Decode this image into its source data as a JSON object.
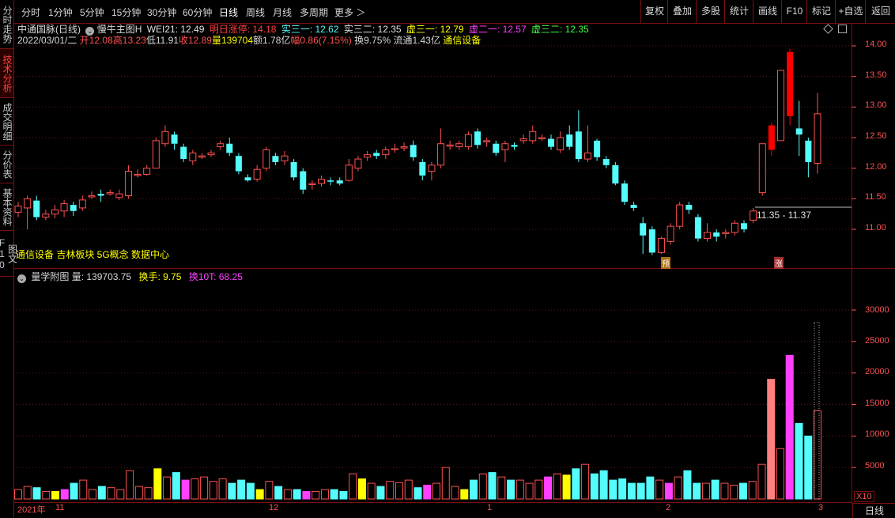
{
  "left_tabs": [
    {
      "label": "分时走势",
      "active": false
    },
    {
      "label": "技术分析",
      "active": true
    },
    {
      "label": "成交明细",
      "active": false
    },
    {
      "label": "分价表",
      "active": false
    },
    {
      "label": "基本资料",
      "active": false
    },
    {
      "label": "图文F10",
      "active": false
    }
  ],
  "toolbar": {
    "periods": [
      "分时",
      "1分钟",
      "5分钟",
      "15分钟",
      "30分钟",
      "60分钟",
      "日线",
      "周线",
      "月线",
      "多周期",
      "更多 ＞"
    ],
    "active_period": "日线",
    "right_buttons": [
      "复权",
      "叠加",
      "多股",
      "统计",
      "画线",
      "F10",
      "标记",
      "+自选",
      "返回"
    ]
  },
  "main_header": {
    "stock_title": "中通国脉(日线)",
    "indicator_name": "慢牛主图H",
    "wei21": "WEI21: 12.49",
    "limit_up": "明日涨停: 14.18",
    "shi31": "实三一: 12.62",
    "shi32": "实三二: 12.35",
    "xu31": "虚三一: 12.79",
    "xu21": "虚二一: 12.57",
    "xu32": "虚三二: 12.35"
  },
  "quote_line": {
    "date": "2022/03/01/二",
    "open": "开12.08",
    "high": "高13.23",
    "low": "低11.91",
    "close": "收12.89",
    "volume": "量139704",
    "amount": "额1.78亿",
    "change": "幅0.86(7.15%)",
    "turnover": "换9.75%",
    "float": "流通1.43亿",
    "industry": "通信设备"
  },
  "concepts": "通信设备 吉林板块 5G概念 数据中心",
  "range_label": "11.35 - 11.37",
  "markers": {
    "pre": "预",
    "up": "涨"
  },
  "sub_header": {
    "name": "量学附图",
    "vol": "量: 139703.75",
    "turnover": "换手: 9.75",
    "turnover10": "换10T: 68.25"
  },
  "price_axis": [
    "14.00",
    "13.50",
    "13.00",
    "12.50",
    "12.00",
    "11.50",
    "11.00"
  ],
  "volume_axis": [
    "30000",
    "25000",
    "20000",
    "15000",
    "10000",
    "5000"
  ],
  "x_labels": [
    "2021年",
    "11",
    "12",
    "1",
    "2",
    "3"
  ],
  "x10": "X10",
  "period_btn": "日线",
  "colors": {
    "up": "#ff5050",
    "down": "#54fcfc",
    "strong_up": "#ff0000",
    "bg": "#000000",
    "border": "#7a1010",
    "accent": "#ffff00",
    "magenta": "#ff40ff"
  },
  "chart_data": {
    "type": "candlestick",
    "ylim": [
      10.6,
      14.25
    ],
    "candles": [
      {
        "o": 11.28,
        "c": 11.38,
        "h": 11.45,
        "l": 11.2
      },
      {
        "o": 11.35,
        "c": 11.5,
        "h": 11.55,
        "l": 11.0
      },
      {
        "o": 11.47,
        "c": 11.2,
        "h": 11.55,
        "l": 11.15
      },
      {
        "o": 11.2,
        "c": 11.25,
        "h": 11.32,
        "l": 11.15
      },
      {
        "o": 11.25,
        "c": 11.32,
        "h": 11.4,
        "l": 11.18
      },
      {
        "o": 11.3,
        "c": 11.42,
        "h": 11.48,
        "l": 11.2
      },
      {
        "o": 11.4,
        "c": 11.3,
        "h": 11.45,
        "l": 11.22
      },
      {
        "o": 11.35,
        "c": 11.48,
        "h": 11.55,
        "l": 11.3
      },
      {
        "o": 11.55,
        "c": 11.55,
        "h": 11.62,
        "l": 11.5
      },
      {
        "o": 11.58,
        "c": 11.55,
        "h": 11.65,
        "l": 11.45
      },
      {
        "o": 11.6,
        "c": 11.6,
        "h": 11.65,
        "l": 11.55
      },
      {
        "o": 11.52,
        "c": 11.58,
        "h": 11.65,
        "l": 11.48
      },
      {
        "o": 11.55,
        "c": 11.95,
        "h": 12.05,
        "l": 11.5
      },
      {
        "o": 11.9,
        "c": 11.9,
        "h": 11.98,
        "l": 11.85
      },
      {
        "o": 11.9,
        "c": 12.0,
        "h": 12.05,
        "l": 11.88
      },
      {
        "o": 12.0,
        "c": 12.45,
        "h": 12.5,
        "l": 12.0
      },
      {
        "o": 12.4,
        "c": 12.6,
        "h": 12.7,
        "l": 12.35
      },
      {
        "o": 12.55,
        "c": 12.4,
        "h": 12.6,
        "l": 12.3
      },
      {
        "o": 12.35,
        "c": 12.15,
        "h": 12.4,
        "l": 12.1
      },
      {
        "o": 12.12,
        "c": 12.25,
        "h": 12.3,
        "l": 12.05
      },
      {
        "o": 12.2,
        "c": 12.2,
        "h": 12.25,
        "l": 12.15
      },
      {
        "o": 12.22,
        "c": 12.25,
        "h": 12.3,
        "l": 12.18
      },
      {
        "o": 12.35,
        "c": 12.4,
        "h": 12.45,
        "l": 12.3
      },
      {
        "o": 12.4,
        "c": 12.25,
        "h": 12.5,
        "l": 12.2
      },
      {
        "o": 12.2,
        "c": 11.95,
        "h": 12.25,
        "l": 11.9
      },
      {
        "o": 11.85,
        "c": 11.8,
        "h": 11.9,
        "l": 11.78
      },
      {
        "o": 11.82,
        "c": 11.98,
        "h": 12.05,
        "l": 11.78
      },
      {
        "o": 12.0,
        "c": 12.3,
        "h": 12.35,
        "l": 11.95
      },
      {
        "o": 12.2,
        "c": 12.1,
        "h": 12.25,
        "l": 12.05
      },
      {
        "o": 12.12,
        "c": 12.2,
        "h": 12.28,
        "l": 12.05
      },
      {
        "o": 12.1,
        "c": 11.85,
        "h": 12.15,
        "l": 11.8
      },
      {
        "o": 11.95,
        "c": 11.65,
        "h": 12.0,
        "l": 11.58
      },
      {
        "o": 11.75,
        "c": 11.75,
        "h": 11.8,
        "l": 11.65
      },
      {
        "o": 11.75,
        "c": 11.82,
        "h": 11.88,
        "l": 11.7
      },
      {
        "o": 11.8,
        "c": 11.78,
        "h": 11.85,
        "l": 11.72
      },
      {
        "o": 11.8,
        "c": 11.75,
        "h": 11.85,
        "l": 11.72
      },
      {
        "o": 11.8,
        "c": 12.05,
        "h": 12.15,
        "l": 11.78
      },
      {
        "o": 12.0,
        "c": 12.15,
        "h": 12.2,
        "l": 11.95
      },
      {
        "o": 12.18,
        "c": 12.22,
        "h": 12.28,
        "l": 12.12
      },
      {
        "o": 12.25,
        "c": 12.2,
        "h": 12.3,
        "l": 12.15
      },
      {
        "o": 12.22,
        "c": 12.3,
        "h": 12.35,
        "l": 12.15
      },
      {
        "o": 12.32,
        "c": 12.32,
        "h": 12.4,
        "l": 12.25
      },
      {
        "o": 12.35,
        "c": 12.35,
        "h": 12.42,
        "l": 12.28
      },
      {
        "o": 12.38,
        "c": 12.18,
        "h": 12.45,
        "l": 12.12
      },
      {
        "o": 12.1,
        "c": 11.88,
        "h": 12.15,
        "l": 11.8
      },
      {
        "o": 11.95,
        "c": 12.05,
        "h": 12.1,
        "l": 11.8
      },
      {
        "o": 12.05,
        "c": 12.4,
        "h": 12.65,
        "l": 12.0
      },
      {
        "o": 12.38,
        "c": 12.38,
        "h": 12.45,
        "l": 12.3
      },
      {
        "o": 12.35,
        "c": 12.4,
        "h": 12.45,
        "l": 12.3
      },
      {
        "o": 12.35,
        "c": 12.55,
        "h": 12.6,
        "l": 12.3
      },
      {
        "o": 12.6,
        "c": 12.38,
        "h": 12.65,
        "l": 12.32
      },
      {
        "o": 12.45,
        "c": 12.45,
        "h": 12.5,
        "l": 12.35
      },
      {
        "o": 12.4,
        "c": 12.25,
        "h": 12.45,
        "l": 12.2
      },
      {
        "o": 12.3,
        "c": 12.4,
        "h": 12.45,
        "l": 12.1
      },
      {
        "o": 12.38,
        "c": 12.35,
        "h": 12.42,
        "l": 12.3
      },
      {
        "o": 12.45,
        "c": 12.48,
        "h": 12.55,
        "l": 12.4
      },
      {
        "o": 12.45,
        "c": 12.6,
        "h": 12.7,
        "l": 12.4
      },
      {
        "o": 12.48,
        "c": 12.5,
        "h": 12.55,
        "l": 12.45
      },
      {
        "o": 12.48,
        "c": 12.35,
        "h": 12.55,
        "l": 12.3
      },
      {
        "o": 12.3,
        "c": 12.5,
        "h": 12.6,
        "l": 12.25
      },
      {
        "o": 12.55,
        "c": 12.35,
        "h": 12.7,
        "l": 12.3
      },
      {
        "o": 12.6,
        "c": 12.15,
        "h": 12.95,
        "l": 12.1
      },
      {
        "o": 12.15,
        "c": 12.25,
        "h": 12.7,
        "l": 12.1
      },
      {
        "o": 12.45,
        "c": 12.18,
        "h": 12.48,
        "l": 12.12
      },
      {
        "o": 12.15,
        "c": 12.05,
        "h": 12.2,
        "l": 12.0
      },
      {
        "o": 12.05,
        "c": 11.75,
        "h": 12.1,
        "l": 11.72
      },
      {
        "o": 11.75,
        "c": 11.45,
        "h": 11.8,
        "l": 11.4
      },
      {
        "o": 11.4,
        "c": 11.35,
        "h": 11.45,
        "l": 11.3
      },
      {
        "o": 11.1,
        "c": 10.9,
        "h": 11.2,
        "l": 10.6
      },
      {
        "o": 11.0,
        "c": 10.62,
        "h": 11.05,
        "l": 10.58
      },
      {
        "o": 10.62,
        "c": 10.85,
        "h": 10.88,
        "l": 10.6
      },
      {
        "o": 10.8,
        "c": 11.05,
        "h": 11.1,
        "l": 10.75
      },
      {
        "o": 11.05,
        "c": 11.4,
        "h": 11.45,
        "l": 11.0
      },
      {
        "o": 11.4,
        "c": 11.32,
        "h": 11.45,
        "l": 11.25
      },
      {
        "o": 11.2,
        "c": 10.85,
        "h": 11.25,
        "l": 10.8
      },
      {
        "o": 10.85,
        "c": 10.95,
        "h": 11.1,
        "l": 10.8
      },
      {
        "o": 10.95,
        "c": 10.88,
        "h": 11.0,
        "l": 10.8
      },
      {
        "o": 10.95,
        "c": 10.95,
        "h": 11.0,
        "l": 10.85
      },
      {
        "o": 10.95,
        "c": 11.1,
        "h": 11.15,
        "l": 10.9
      },
      {
        "o": 11.1,
        "c": 11.0,
        "h": 11.15,
        "l": 10.95
      },
      {
        "o": 11.15,
        "c": 11.3,
        "h": 11.35,
        "l": 11.1
      },
      {
        "o": 11.6,
        "c": 12.4,
        "h": 12.4,
        "l": 11.55
      },
      {
        "o": 12.7,
        "c": 12.3,
        "h": 12.75,
        "l": 12.2
      },
      {
        "o": 12.45,
        "c": 13.6,
        "h": 13.6,
        "l": 12.45
      },
      {
        "o": 13.9,
        "c": 12.85,
        "h": 13.95,
        "l": 12.7
      },
      {
        "o": 12.65,
        "c": 12.55,
        "h": 13.1,
        "l": 12.2
      },
      {
        "o": 12.45,
        "c": 12.1,
        "h": 12.5,
        "l": 11.85
      },
      {
        "o": 12.08,
        "c": 12.89,
        "h": 13.23,
        "l": 11.91
      }
    ],
    "volume_ylim": [
      0,
      35000
    ],
    "volumes": [
      1500,
      2000,
      1800,
      1200,
      1200,
      1500,
      2500,
      3000,
      1500,
      2000,
      1800,
      1500,
      4500,
      2000,
      1800,
      4800,
      3500,
      4200,
      3000,
      3200,
      3500,
      2800,
      3200,
      2500,
      3000,
      2500,
      1500,
      2800,
      2000,
      1500,
      1500,
      1200,
      1200,
      1500,
      1500,
      1200,
      4000,
      3200,
      2500,
      2000,
      2800,
      2600,
      3000,
      1800,
      2200,
      2500,
      5000,
      2000,
      1500,
      3000,
      4000,
      4200,
      3500,
      3000,
      3000,
      2500,
      3000,
      3500,
      4000,
      3800,
      4800,
      5500,
      4000,
      4500,
      3000,
      3200,
      2500,
      2500,
      3500,
      3000,
      2500,
      3500,
      4500,
      2500,
      2500,
      3000,
      2500,
      2200,
      2500,
      2800,
      5500,
      19000,
      8000,
      22800,
      12000,
      10000,
      14000
    ],
    "volume_flags": "dduudddddudu y dd ud..."
  }
}
